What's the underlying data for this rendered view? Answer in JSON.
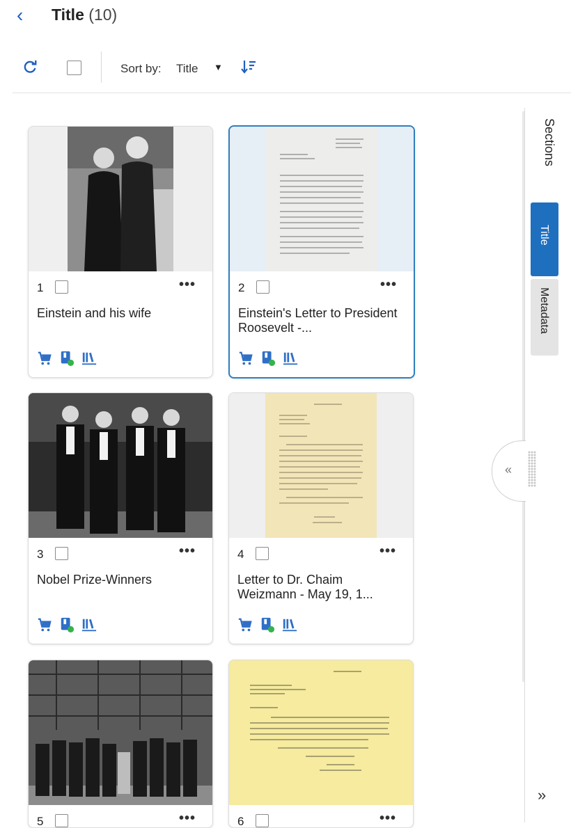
{
  "header": {
    "back_glyph": "‹",
    "title": "Title",
    "count": "(10)"
  },
  "toolbar": {
    "sort_label": "Sort by:",
    "sort_value": "Title",
    "sort_caret": "▼"
  },
  "side_panel": {
    "sections_label": "Sections",
    "tabs": [
      "Title",
      "Metadata"
    ],
    "collapse_glyph": "«",
    "expand_glyph": "»"
  },
  "colors": {
    "accent": "#1f6fbf",
    "icon_blue": "#2f6fc6",
    "status_green": "#36b24a"
  },
  "cards": [
    {
      "number": "1",
      "title": "Einstein and his wife"
    },
    {
      "number": "2",
      "title": "Einstein's Letter to President Roosevelt -..."
    },
    {
      "number": "3",
      "title": "Nobel Prize-Winners"
    },
    {
      "number": "4",
      "title": "Letter to Dr. Chaim Weizmann - May 19, 1..."
    },
    {
      "number": "5",
      "title": ""
    },
    {
      "number": "6",
      "title": ""
    }
  ],
  "card_more_glyph": "•••"
}
